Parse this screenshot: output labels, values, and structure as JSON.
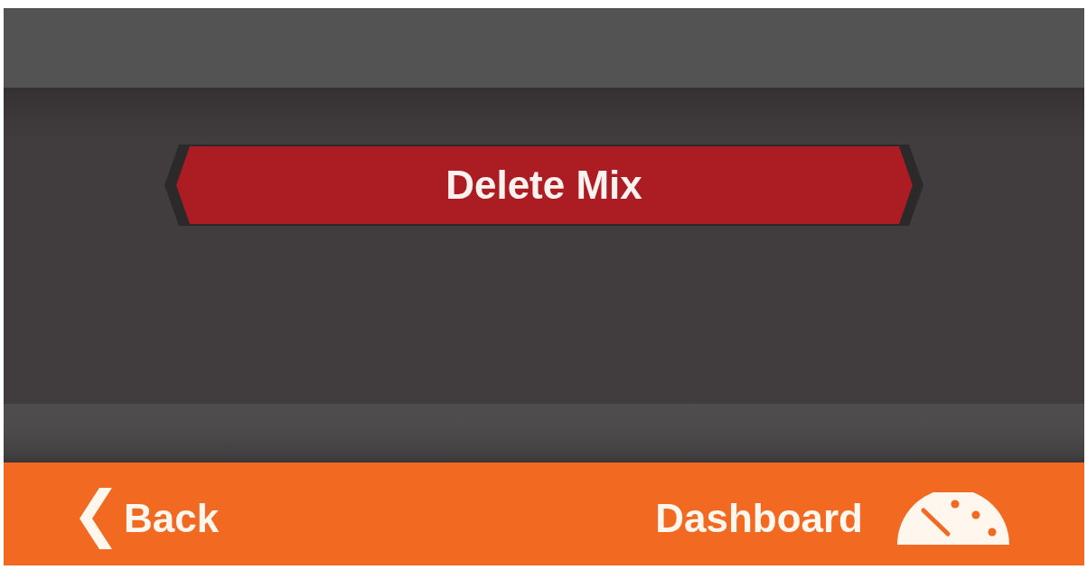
{
  "action_button": {
    "label": "Delete Mix"
  },
  "footer": {
    "back_button": {
      "label": "Back"
    },
    "dashboard_button": {
      "label": "Dashboard"
    }
  }
}
